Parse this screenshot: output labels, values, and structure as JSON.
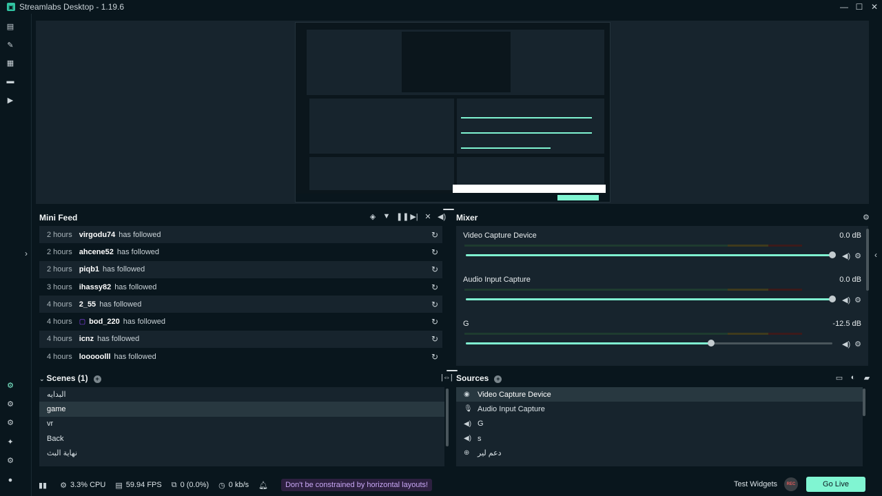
{
  "app": {
    "title": "Streamlabs Desktop - 1.19.6"
  },
  "window_controls": {
    "minimize": "—",
    "maximize": "☐",
    "close": "✕"
  },
  "minifeed": {
    "title": "Mini Feed",
    "rows": [
      {
        "time": "2 hours",
        "user": "virgodu74",
        "action": "has followed"
      },
      {
        "time": "2 hours",
        "user": "ahcene52",
        "action": "has followed"
      },
      {
        "time": "2 hours",
        "user": "piqb1",
        "action": "has followed"
      },
      {
        "time": "3 hours",
        "user": "ihassy82",
        "action": "has followed"
      },
      {
        "time": "4 hours",
        "user": "2_55",
        "action": "has followed"
      },
      {
        "time": "4 hours",
        "user": "bod_220",
        "action": "has followed"
      },
      {
        "time": "4 hours",
        "user": "icnz",
        "action": "has followed"
      },
      {
        "time": "4 hours",
        "user": "looooolll",
        "action": "has followed"
      }
    ]
  },
  "mixer": {
    "title": "Mixer",
    "items": [
      {
        "name": "Video Capture Device",
        "db": "0.0 dB",
        "level": 1.0
      },
      {
        "name": "Audio Input Capture",
        "db": "0.0 dB",
        "level": 1.0
      },
      {
        "name": "G",
        "db": "-12.5 dB",
        "level": 0.67
      }
    ]
  },
  "scenes": {
    "title": "Scenes (1)",
    "items": [
      {
        "label": "البدايه",
        "selected": false
      },
      {
        "label": "game",
        "selected": true
      },
      {
        "label": "vr",
        "selected": false
      },
      {
        "label": "Back",
        "selected": false
      },
      {
        "label": "نهاية البث",
        "selected": false
      }
    ]
  },
  "sources": {
    "title": "Sources",
    "items": [
      {
        "label": "Video Capture Device",
        "icon": "webcam-icon",
        "selected": true
      },
      {
        "label": "Audio Input Capture",
        "icon": "mic-icon",
        "selected": false
      },
      {
        "label": "G",
        "icon": "speaker-icon",
        "selected": false
      },
      {
        "label": "s",
        "icon": "speaker-icon",
        "selected": false
      },
      {
        "label": "دعم لير",
        "icon": "globe-icon",
        "selected": false
      }
    ]
  },
  "status": {
    "cpu": "3.3% CPU",
    "fps": "59.94 FPS",
    "dropped": "0 (0.0%)",
    "bandwidth": "0 kb/s",
    "promo": "Don't be constrained by horizontal layouts!"
  },
  "actions": {
    "test_widgets": "Test Widgets",
    "rec": "REC",
    "go_live": "Go Live"
  }
}
